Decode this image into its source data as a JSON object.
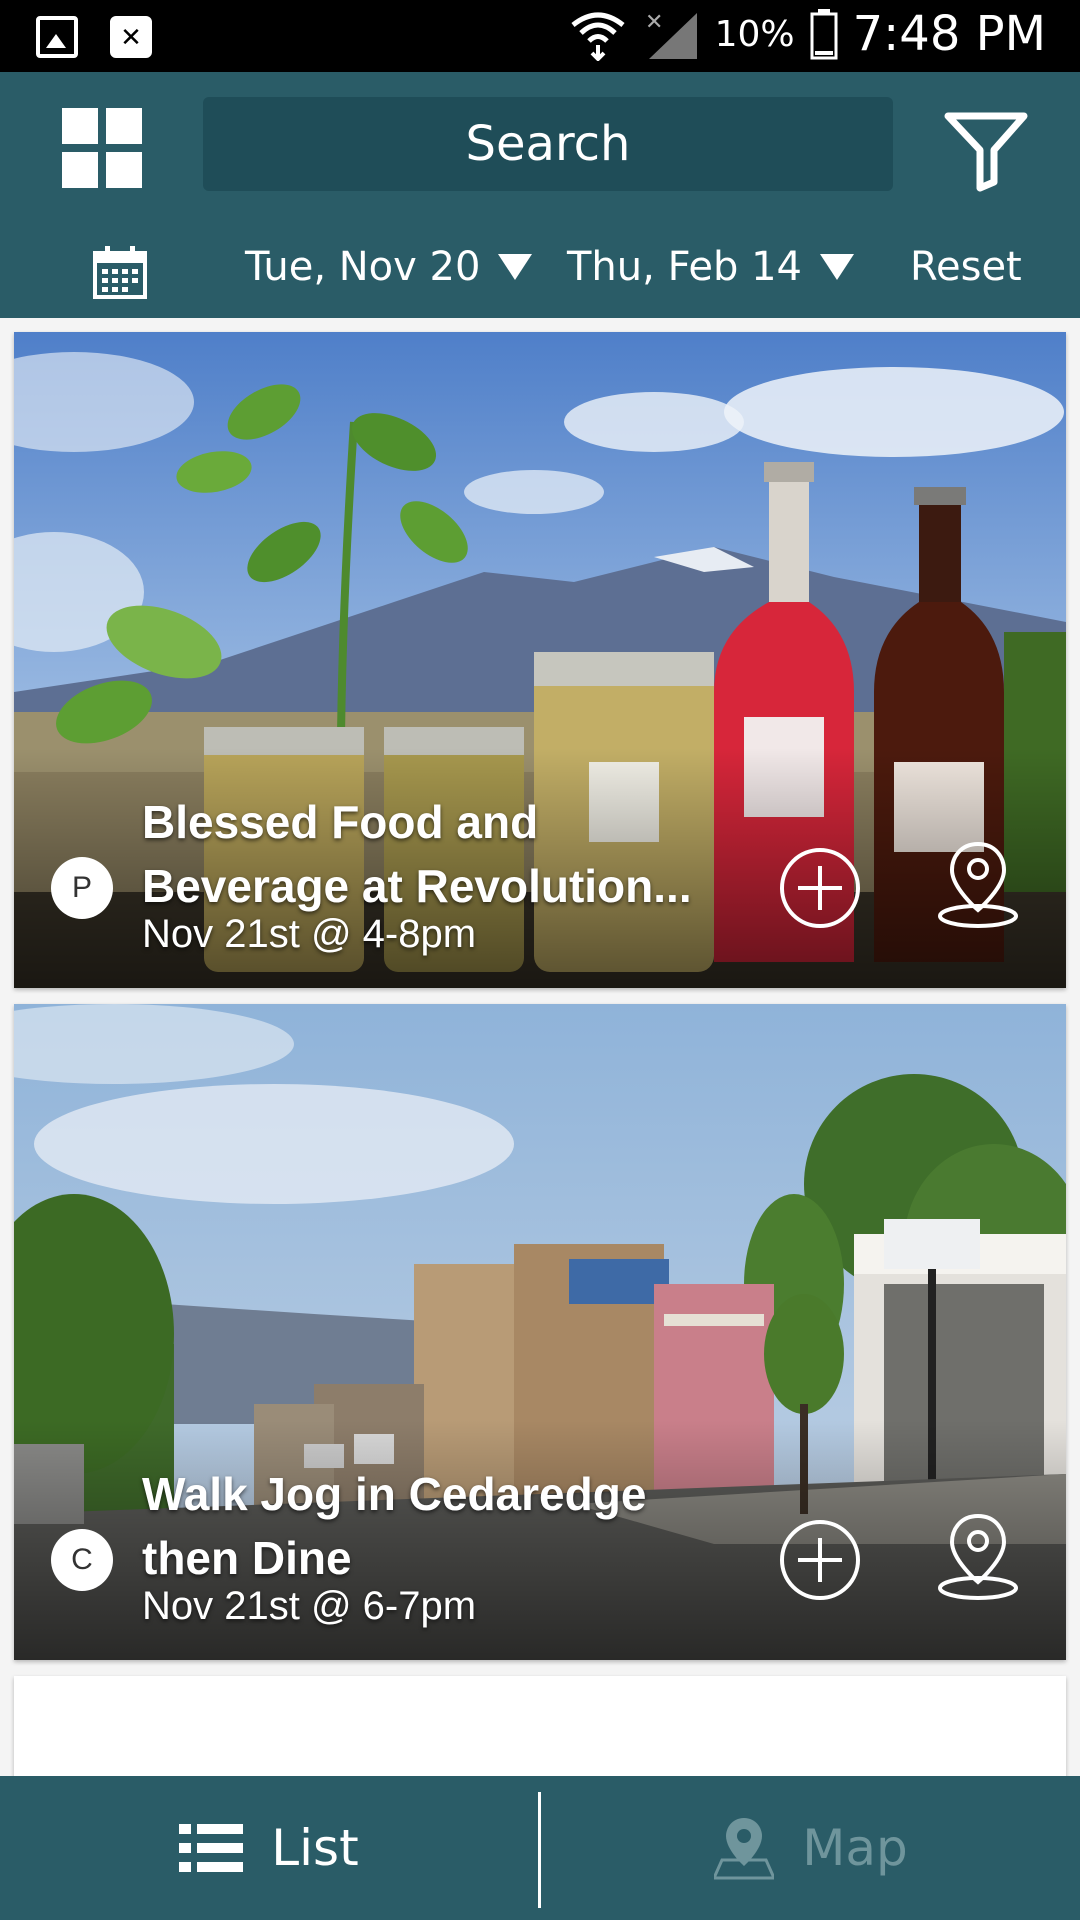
{
  "status_bar": {
    "battery": "10%",
    "time": "7:48 PM"
  },
  "header": {
    "search_placeholder": "Search"
  },
  "date_bar": {
    "start_date": "Tue, Nov 20",
    "end_date": "Thu, Feb 14",
    "reset_label": "Reset"
  },
  "events": [
    {
      "badge": "P",
      "title": "Blessed Food and Beverage at Revolution...",
      "title_line1": "Blessed Food and",
      "title_line2": "Beverage at Revolution...",
      "date": "Nov 21st @ 4-8pm"
    },
    {
      "badge": "C",
      "title": "Walk Jog in Cedaredge then Dine",
      "title_line1": "Walk Jog in Cedaredge",
      "title_line2": "then Dine",
      "date": "Nov 21st @ 6-7pm"
    }
  ],
  "bottom_nav": {
    "list_label": "List",
    "map_label": "Map"
  },
  "colors": {
    "primary": "#2a5c67",
    "search_bg": "#1f4d58",
    "inactive_tab": "#6f959c"
  }
}
